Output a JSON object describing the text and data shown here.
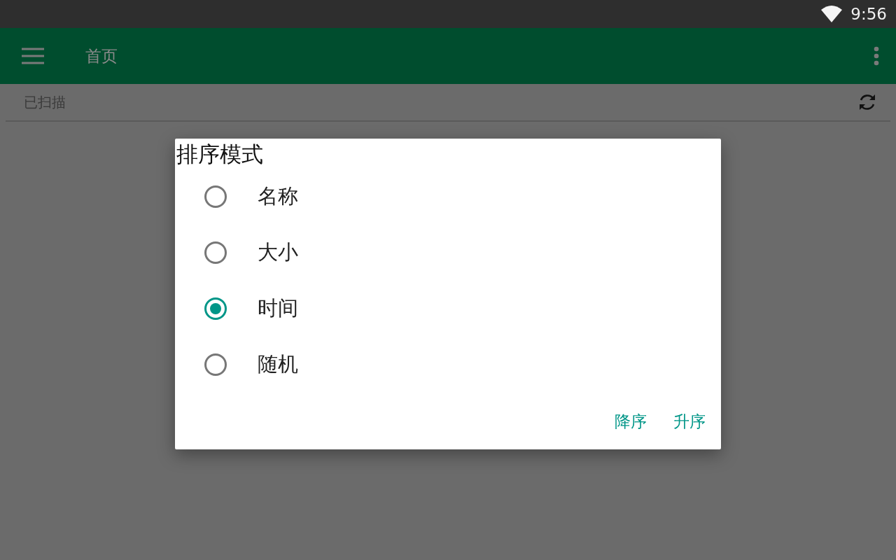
{
  "status_bar": {
    "time": "9:56"
  },
  "app_bar": {
    "title": "首页"
  },
  "subheader": {
    "label": "已扫描"
  },
  "dialog": {
    "title": "排序模式",
    "options": [
      {
        "label": "名称",
        "selected": false
      },
      {
        "label": "大小",
        "selected": false
      },
      {
        "label": "时间",
        "selected": true
      },
      {
        "label": "随机",
        "selected": false
      }
    ],
    "buttons": [
      "降序",
      "升序"
    ]
  }
}
